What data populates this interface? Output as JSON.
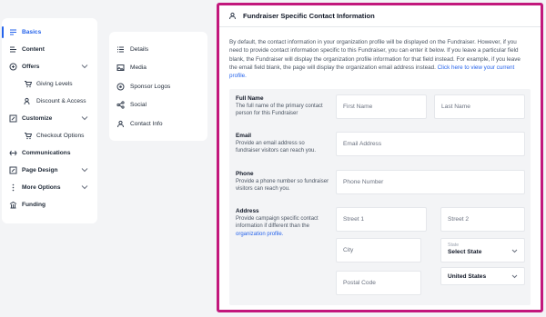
{
  "sidebar": {
    "items": [
      {
        "label": "Basics",
        "icon": "basics-icon"
      },
      {
        "label": "Content",
        "icon": "content-icon"
      },
      {
        "label": "Offers",
        "icon": "offers-icon"
      },
      {
        "label": "Giving Levels",
        "icon": "cart-icon"
      },
      {
        "label": "Discount & Access",
        "icon": "discount-icon"
      },
      {
        "label": "Customize",
        "icon": "customize-icon"
      },
      {
        "label": "Checkout Options",
        "icon": "cart-icon"
      },
      {
        "label": "Communications",
        "icon": "communications-icon"
      },
      {
        "label": "Page Design",
        "icon": "page-design-icon"
      },
      {
        "label": "More Options",
        "icon": "more-options-icon"
      },
      {
        "label": "Funding",
        "icon": "funding-icon"
      }
    ]
  },
  "subnav": {
    "items": [
      {
        "label": "Details"
      },
      {
        "label": "Media"
      },
      {
        "label": "Sponsor Logos"
      },
      {
        "label": "Social"
      },
      {
        "label": "Contact Info"
      }
    ]
  },
  "card": {
    "title": "Fundraiser Specific Contact Information",
    "description": "By default, the contact information in your organization profile will be displayed on the Fundraiser. However, if you need to provide contact information specific to this Fundraiser, you can enter it below. If you leave a particular field blank, the Fundraiser will display the organization profile information for that field instead. For example, if you leave the email field blank, the page will display the organization email address instead.",
    "description_link": "Click here to view your current profile."
  },
  "form": {
    "full_name": {
      "title": "Full Name",
      "subtitle": "The full name of the primary contact person for this Fundraiser",
      "first_placeholder": "First Name",
      "last_placeholder": "Last Name"
    },
    "email": {
      "title": "Email",
      "subtitle": "Provide an email address so fundraiser visitors can reach you.",
      "placeholder": "Email Address"
    },
    "phone": {
      "title": "Phone",
      "subtitle": "Provide a phone number so fundraiser visitors can reach you.",
      "placeholder": "Phone Number"
    },
    "address": {
      "title": "Address",
      "subtitle": "Provide campaign specific contact information if different than the",
      "subtitle_link": "organization profile.",
      "street1_placeholder": "Street 1",
      "street2_placeholder": "Street 2",
      "city_placeholder": "City",
      "state_label": "State",
      "state_value": "Select State",
      "postal_placeholder": "Postal Code",
      "country_value": "United States"
    }
  },
  "colors": {
    "accent": "#2563eb",
    "highlight_border": "#c2187c"
  }
}
